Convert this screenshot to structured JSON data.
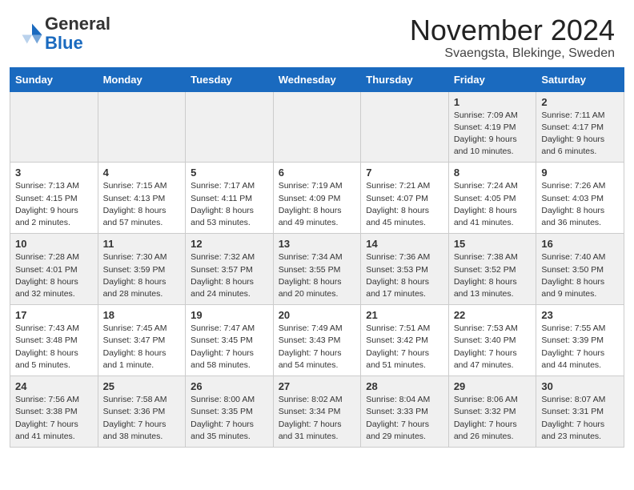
{
  "logo": {
    "general": "General",
    "blue": "Blue"
  },
  "title": "November 2024",
  "subtitle": "Svaengsta, Blekinge, Sweden",
  "days_of_week": [
    "Sunday",
    "Monday",
    "Tuesday",
    "Wednesday",
    "Thursday",
    "Friday",
    "Saturday"
  ],
  "weeks": [
    [
      {
        "day": "",
        "info": ""
      },
      {
        "day": "",
        "info": ""
      },
      {
        "day": "",
        "info": ""
      },
      {
        "day": "",
        "info": ""
      },
      {
        "day": "",
        "info": ""
      },
      {
        "day": "1",
        "info": "Sunrise: 7:09 AM\nSunset: 4:19 PM\nDaylight: 9 hours\nand 10 minutes."
      },
      {
        "day": "2",
        "info": "Sunrise: 7:11 AM\nSunset: 4:17 PM\nDaylight: 9 hours\nand 6 minutes."
      }
    ],
    [
      {
        "day": "3",
        "info": "Sunrise: 7:13 AM\nSunset: 4:15 PM\nDaylight: 9 hours\nand 2 minutes."
      },
      {
        "day": "4",
        "info": "Sunrise: 7:15 AM\nSunset: 4:13 PM\nDaylight: 8 hours\nand 57 minutes."
      },
      {
        "day": "5",
        "info": "Sunrise: 7:17 AM\nSunset: 4:11 PM\nDaylight: 8 hours\nand 53 minutes."
      },
      {
        "day": "6",
        "info": "Sunrise: 7:19 AM\nSunset: 4:09 PM\nDaylight: 8 hours\nand 49 minutes."
      },
      {
        "day": "7",
        "info": "Sunrise: 7:21 AM\nSunset: 4:07 PM\nDaylight: 8 hours\nand 45 minutes."
      },
      {
        "day": "8",
        "info": "Sunrise: 7:24 AM\nSunset: 4:05 PM\nDaylight: 8 hours\nand 41 minutes."
      },
      {
        "day": "9",
        "info": "Sunrise: 7:26 AM\nSunset: 4:03 PM\nDaylight: 8 hours\nand 36 minutes."
      }
    ],
    [
      {
        "day": "10",
        "info": "Sunrise: 7:28 AM\nSunset: 4:01 PM\nDaylight: 8 hours\nand 32 minutes."
      },
      {
        "day": "11",
        "info": "Sunrise: 7:30 AM\nSunset: 3:59 PM\nDaylight: 8 hours\nand 28 minutes."
      },
      {
        "day": "12",
        "info": "Sunrise: 7:32 AM\nSunset: 3:57 PM\nDaylight: 8 hours\nand 24 minutes."
      },
      {
        "day": "13",
        "info": "Sunrise: 7:34 AM\nSunset: 3:55 PM\nDaylight: 8 hours\nand 20 minutes."
      },
      {
        "day": "14",
        "info": "Sunrise: 7:36 AM\nSunset: 3:53 PM\nDaylight: 8 hours\nand 17 minutes."
      },
      {
        "day": "15",
        "info": "Sunrise: 7:38 AM\nSunset: 3:52 PM\nDaylight: 8 hours\nand 13 minutes."
      },
      {
        "day": "16",
        "info": "Sunrise: 7:40 AM\nSunset: 3:50 PM\nDaylight: 8 hours\nand 9 minutes."
      }
    ],
    [
      {
        "day": "17",
        "info": "Sunrise: 7:43 AM\nSunset: 3:48 PM\nDaylight: 8 hours\nand 5 minutes."
      },
      {
        "day": "18",
        "info": "Sunrise: 7:45 AM\nSunset: 3:47 PM\nDaylight: 8 hours\nand 1 minute."
      },
      {
        "day": "19",
        "info": "Sunrise: 7:47 AM\nSunset: 3:45 PM\nDaylight: 7 hours\nand 58 minutes."
      },
      {
        "day": "20",
        "info": "Sunrise: 7:49 AM\nSunset: 3:43 PM\nDaylight: 7 hours\nand 54 minutes."
      },
      {
        "day": "21",
        "info": "Sunrise: 7:51 AM\nSunset: 3:42 PM\nDaylight: 7 hours\nand 51 minutes."
      },
      {
        "day": "22",
        "info": "Sunrise: 7:53 AM\nSunset: 3:40 PM\nDaylight: 7 hours\nand 47 minutes."
      },
      {
        "day": "23",
        "info": "Sunrise: 7:55 AM\nSunset: 3:39 PM\nDaylight: 7 hours\nand 44 minutes."
      }
    ],
    [
      {
        "day": "24",
        "info": "Sunrise: 7:56 AM\nSunset: 3:38 PM\nDaylight: 7 hours\nand 41 minutes."
      },
      {
        "day": "25",
        "info": "Sunrise: 7:58 AM\nSunset: 3:36 PM\nDaylight: 7 hours\nand 38 minutes."
      },
      {
        "day": "26",
        "info": "Sunrise: 8:00 AM\nSunset: 3:35 PM\nDaylight: 7 hours\nand 35 minutes."
      },
      {
        "day": "27",
        "info": "Sunrise: 8:02 AM\nSunset: 3:34 PM\nDaylight: 7 hours\nand 31 minutes."
      },
      {
        "day": "28",
        "info": "Sunrise: 8:04 AM\nSunset: 3:33 PM\nDaylight: 7 hours\nand 29 minutes."
      },
      {
        "day": "29",
        "info": "Sunrise: 8:06 AM\nSunset: 3:32 PM\nDaylight: 7 hours\nand 26 minutes."
      },
      {
        "day": "30",
        "info": "Sunrise: 8:07 AM\nSunset: 3:31 PM\nDaylight: 7 hours\nand 23 minutes."
      }
    ]
  ]
}
